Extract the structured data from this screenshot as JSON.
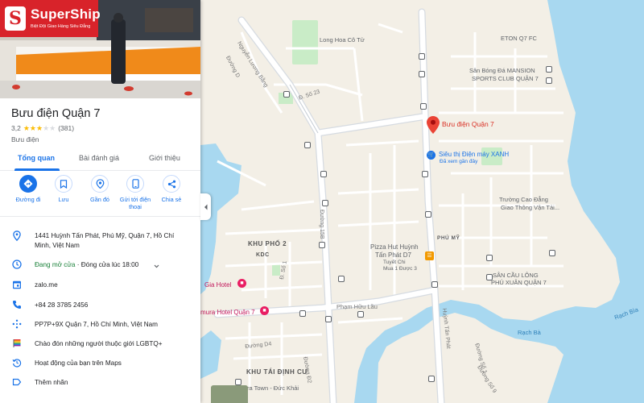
{
  "brand": {
    "name": "SuperShip",
    "slogan": "Biệt Đội Giao Hàng Siêu Đẳng",
    "logo_letter": "S",
    "color": "#d8232a"
  },
  "place": {
    "title": "Bưu điện Quận 7",
    "rating": "3,2",
    "stars_filled": 3,
    "stars_total": 5,
    "review_count": "(381)",
    "category": "Bưu điện"
  },
  "tabs": [
    {
      "label": "Tổng quan",
      "active": true
    },
    {
      "label": "Bài đánh giá",
      "active": false
    },
    {
      "label": "Giới thiệu",
      "active": false
    }
  ],
  "actions": [
    {
      "label": "Đường đi",
      "icon": "directions-icon"
    },
    {
      "label": "Lưu",
      "icon": "bookmark-icon"
    },
    {
      "label": "Gần đó",
      "icon": "nearby-icon"
    },
    {
      "label": "Gửi tới điện thoại",
      "icon": "send-to-phone-icon"
    },
    {
      "label": "Chia sẻ",
      "icon": "share-icon"
    }
  ],
  "info": {
    "address": "1441 Huỳnh Tấn Phát, Phú Mỹ, Quận 7, Hồ Chí Minh, Việt Nam",
    "hours_status": "Đang mở cửa",
    "hours_detail": " · Đóng cửa lúc 18:00",
    "website": "zalo.me",
    "phone": "+84 28 3785 2456",
    "plus_code": "PP7P+9X Quận 7, Hồ Chí Minh, Việt Nam",
    "lgbtq": "Chào đón những người thuộc giới LGBTQ+",
    "activity": "Hoạt động của bạn trên Maps",
    "add_label": "Thêm nhãn"
  },
  "map": {
    "marker_label": "Bưu điện Quận 7",
    "labels": {
      "long_hoa": "Long Hoa Cô Tử",
      "eton": "ETON Q7 FC",
      "mansion_1": "Sân Bóng Đá MANSION",
      "mansion_2": "SPORTS CLUB QUẬN 7",
      "nguyen_luong_bang": "Nguyễn Lương Bằng",
      "duong_d": "Đường D",
      "d_so_23": "Đ. Số 23",
      "dmx_1": "Siêu thị Điện máy XANH",
      "dmx_2": "Đã xem gần đây",
      "cao_dang_1": "Trường Cao Đẳng",
      "cao_dang_2": "Giao Thông Vận Tải...",
      "khu_pho_2": "KHU PHỐ 2",
      "kdc": "KDC",
      "duong_15b": "Đường 15B",
      "pizza_1": "Pizza Hut Huỳnh",
      "pizza_2": "Tấn Phát D7",
      "tuyet_chi_1": "Tuyết Chi",
      "tuyet_chi_2": "Mua 1 Được 3",
      "phu_my": "PHÚ MỸ",
      "d_so_1": "Đ. Số 1",
      "gia_hotel": "Gia Hotel",
      "pham_huu_lau": "Phạm Hữu Lầu",
      "sam_cau_1": "SÂN CẦU LÔNG",
      "sam_cau_2": "PHÚ XUÂN QUẬN 7",
      "rach_ba": "Rạch Bà",
      "rach_bia": "Rạch Bìa",
      "mura_hotel": "mura Hotel Quận 7",
      "duong_d4": "Đường D4",
      "khu_tai_dinh_cu": "KHU TÁI ĐỊNH CƯ",
      "huynh_tan_phat": "Huỳnh Tấn Phát",
      "duong_so_1": "Đường Số 1",
      "duong_so_9": "Đường Số 9",
      "ra_town": "ra Town - Đức Khải",
      "duong_d2": "Đường Đ2"
    }
  },
  "colors": {
    "accent": "#1a73e8",
    "open_green": "#188038",
    "water": "#a8d8f0",
    "land": "#f3efe6",
    "park": "#c9ecc7",
    "marker": "#ea4335"
  }
}
